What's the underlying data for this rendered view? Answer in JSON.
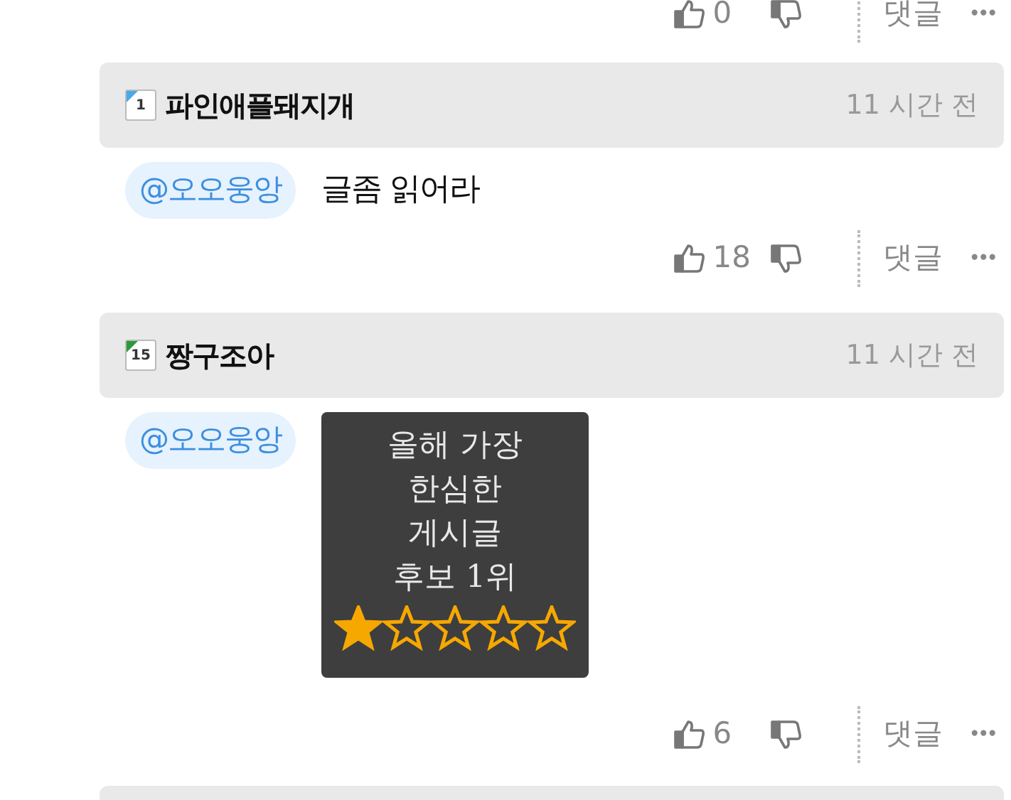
{
  "top_actions": {
    "likes": "0",
    "reply": "댓글",
    "more": "•••"
  },
  "comments": [
    {
      "author": "파인애플돼지개",
      "level": "1",
      "color": "#4aa8e8",
      "time": "11 시간 전",
      "mention": "@오오웅앙",
      "kind": "text",
      "text": "글좀 읽어라",
      "likes": "18",
      "reply": "댓글",
      "more": "•••"
    },
    {
      "author": "짱구조아",
      "level": "15",
      "color": "#2a9a3a",
      "time": "11 시간 전",
      "mention": "@오오웅앙",
      "kind": "sticker",
      "sticker_lines": [
        "올해 가장",
        "한심한",
        "게시글",
        "후보 1위"
      ],
      "stars": 1,
      "likes": "6",
      "reply": "댓글",
      "more": "•••"
    }
  ]
}
